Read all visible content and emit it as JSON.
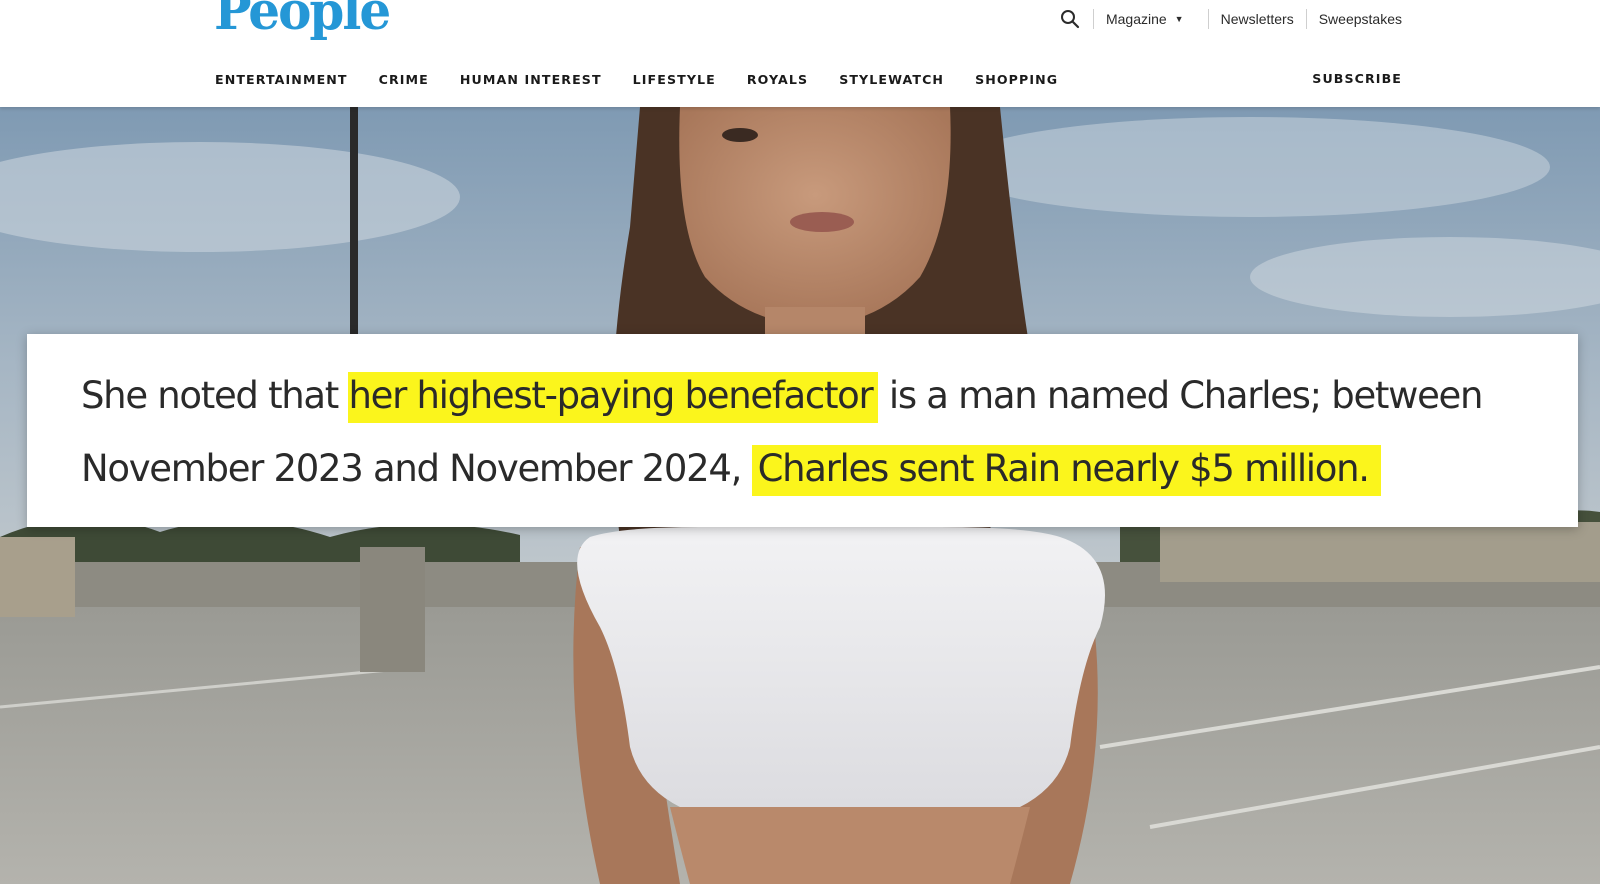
{
  "header": {
    "logo_text": "People",
    "utility": {
      "magazine_label": "Magazine",
      "newsletters_label": "Newsletters",
      "sweepstakes_label": "Sweepstakes"
    },
    "nav": [
      {
        "label": "ENTERTAINMENT"
      },
      {
        "label": "CRIME"
      },
      {
        "label": "HUMAN INTEREST"
      },
      {
        "label": "LIFESTYLE"
      },
      {
        "label": "ROYALS"
      },
      {
        "label": "STYLEWATCH"
      },
      {
        "label": "SHOPPING"
      }
    ],
    "subscribe_label": "SUBSCRIBE"
  },
  "quote": {
    "part1": "She noted that ",
    "highlight1": "her highest-paying benefactor",
    "part2": " is a man named Charles; between",
    "part3": "November 2023 and November 2024, ",
    "highlight2": "Charles sent Rain nearly $5 million."
  },
  "colors": {
    "logo": "#2597d6",
    "highlight": "#fbf51c",
    "nav_text": "#1a1a1a",
    "card_bg": "#ffffff"
  },
  "icons": {
    "search": "search-icon",
    "caret": "caret-down-icon"
  }
}
